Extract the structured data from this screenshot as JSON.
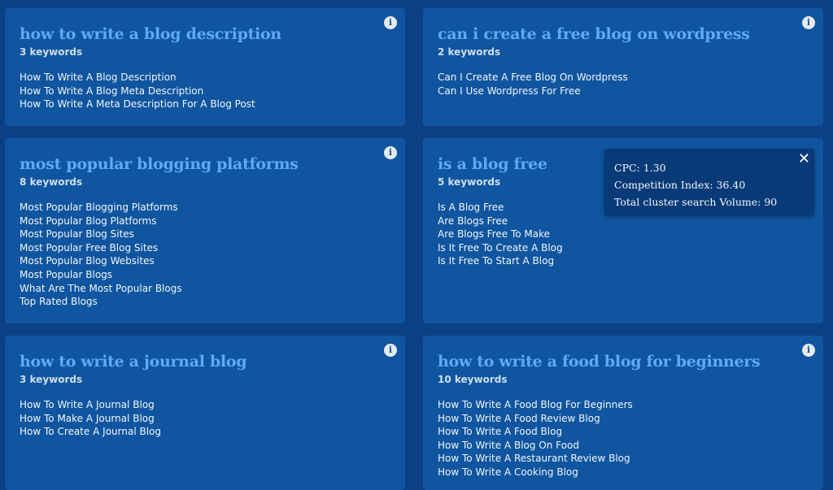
{
  "cards": [
    {
      "title": "how to write a blog description",
      "count": "3 keywords",
      "info_icon": "info-icon",
      "keywords": [
        "How To Write A Blog Description",
        "How To Write A Blog Meta Description",
        "How To Write A Meta Description For A Blog Post"
      ]
    },
    {
      "title": "can i create a free blog on wordpress",
      "count": "2 keywords",
      "info_icon": "info-icon",
      "keywords": [
        "Can I Create A Free Blog On Wordpress",
        "Can I Use Wordpress For Free"
      ]
    },
    {
      "title": "most popular blogging platforms",
      "count": "8 keywords",
      "info_icon": "info-icon",
      "keywords": [
        "Most Popular Blogging Platforms",
        "Most Popular Blog Platforms",
        "Most Popular Blog Sites",
        "Most Popular Free Blog Sites",
        "Most Popular Blog Websites",
        "Most Popular Blogs",
        "What Are The Most Popular Blogs",
        "Top Rated Blogs"
      ]
    },
    {
      "title": "is a blog free",
      "count": "5 keywords",
      "keywords": [
        "Is A Blog Free",
        "Are Blogs Free",
        "Are Blogs Free To Make",
        "Is It Free To Create A Blog",
        "Is It Free To Start A Blog"
      ]
    },
    {
      "title": "how to write a journal blog",
      "count": "3 keywords",
      "info_icon": "info-icon",
      "keywords": [
        "How To Write A Journal Blog",
        "How To Make A Journal Blog",
        "How To Create A Journal Blog"
      ]
    },
    {
      "title": "how to write a food blog for beginners",
      "count": "10 keywords",
      "info_icon": "info-icon",
      "keywords": [
        "How To Write A Food Blog For Beginners",
        "How To Write A Food Review Blog",
        "How To Write A Food Blog",
        "How To Write A Blog On Food",
        "How To Write A Restaurant Review Blog",
        "How To Write A Cooking Blog"
      ]
    }
  ],
  "tooltip": {
    "cpc": "CPC: 1.30",
    "competition": "Competition Index: 36.40",
    "volume": "Total cluster search Volume: 90",
    "close_icon": "close-icon"
  },
  "colors": {
    "page_bg": "#0b4184",
    "card_bg": "#10559f",
    "title": "#5dabf5",
    "tooltip_bg": "#083a78"
  }
}
